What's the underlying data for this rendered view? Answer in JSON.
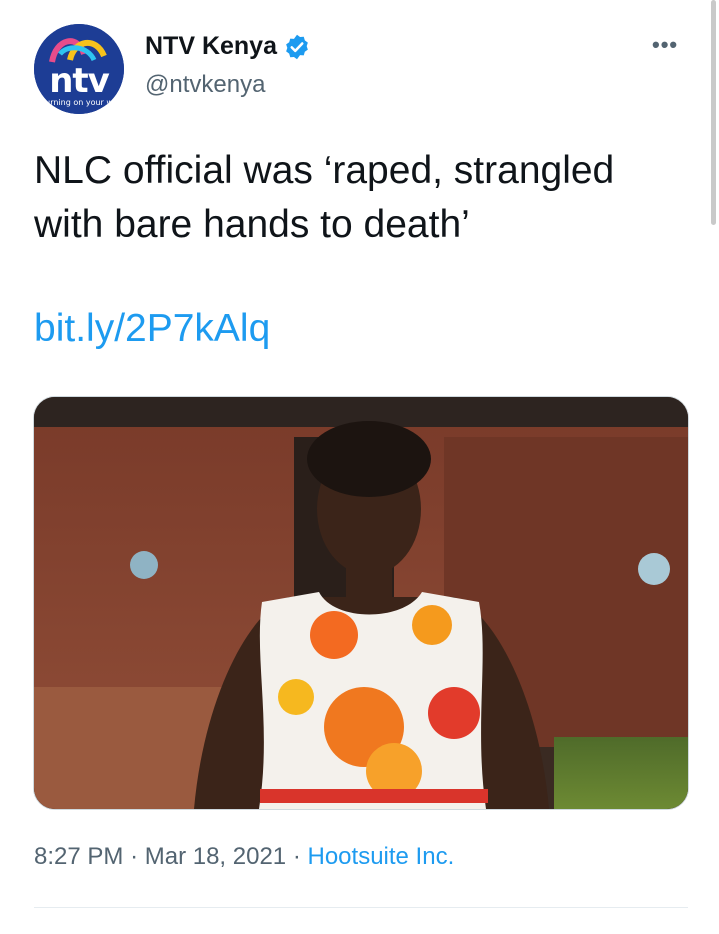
{
  "account": {
    "display_name": "NTV Kenya",
    "handle": "@ntvkenya",
    "avatar_logo": "ntv",
    "avatar_tagline": "turning on your world",
    "verified": true
  },
  "tweet": {
    "text": "NLC official was ‘raped, strangled with bare hands to death’",
    "link": "bit.ly/2P7kAlq",
    "time": "8:27 PM",
    "date": "Mar 18, 2021",
    "separator": "·",
    "source": "Hootsuite Inc."
  },
  "menu": {
    "more_label": "•••"
  },
  "colors": {
    "accent": "#1d9bf0",
    "verified": "#1d9bf0",
    "secondary_text": "#536471",
    "avatar_bg": "#1d3d95"
  }
}
